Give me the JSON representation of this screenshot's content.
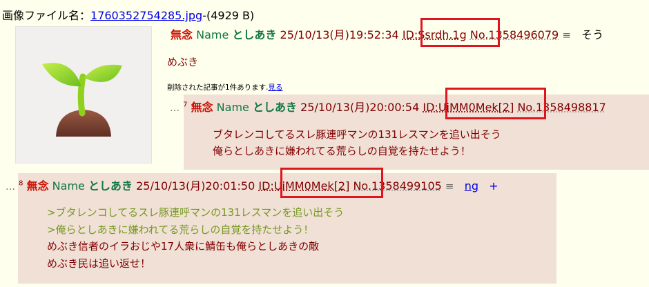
{
  "file": {
    "label": "画像ファイル名：",
    "filename": "1760352754285.jpg",
    "meta": "-(4929 B)"
  },
  "thumbnail": {
    "icon": "seedling-icon"
  },
  "op": {
    "subject": "無念",
    "name_label": "Name",
    "poster": "としあき",
    "date": "25/10/13(月)19:52:34",
    "id": "ID:Ssrdh.1g",
    "no": "No.1358496079",
    "menu": "≡",
    "extra": "そう",
    "body": "めぶき",
    "deleted_text": "削除された記事が1件あります.",
    "deleted_link": "見る"
  },
  "reply1": {
    "ellipsis": "…",
    "num": "7",
    "subject": "無念",
    "name_label": "Name",
    "poster": "としあき",
    "date": "25/10/13(月)20:00:54",
    "id": "ID:UiMM0Mek[2]",
    "no": "No.1358498817",
    "lines": [
      "ブタレンコしてるスレ豚連呼マンの131レスマンを追い出そう",
      "俺らとしあきに嫌われてる荒らしの自覚を持たせよう！"
    ]
  },
  "reply2": {
    "ellipsis": "…",
    "num": "8",
    "subject": "無念",
    "name_label": "Name",
    "poster": "としあき",
    "date": "25/10/13(月)20:01:50",
    "id": "ID:UiMM0Mek[2]",
    "no": "No.1358499105",
    "menu": "≡",
    "ng": "ng",
    "plus": "+",
    "quotes": [
      ">ブタレンコしてるスレ豚連呼マンの131レスマンを追い出そう",
      ">俺らとしあきに嫌われてる荒らしの自覚を持たせよう！"
    ],
    "lines": [
      "めぶき信者のイラおじや17人衆に鯖缶も俺らとしあきの敵",
      "めぶき民は追い返せ！"
    ]
  },
  "colors": {
    "background": "#ffffee",
    "reply_bg": "#f0e0d6",
    "highlight_box": "#e0141e",
    "poster": "#117743",
    "subject": "#cc1105",
    "quote": "#789922"
  }
}
